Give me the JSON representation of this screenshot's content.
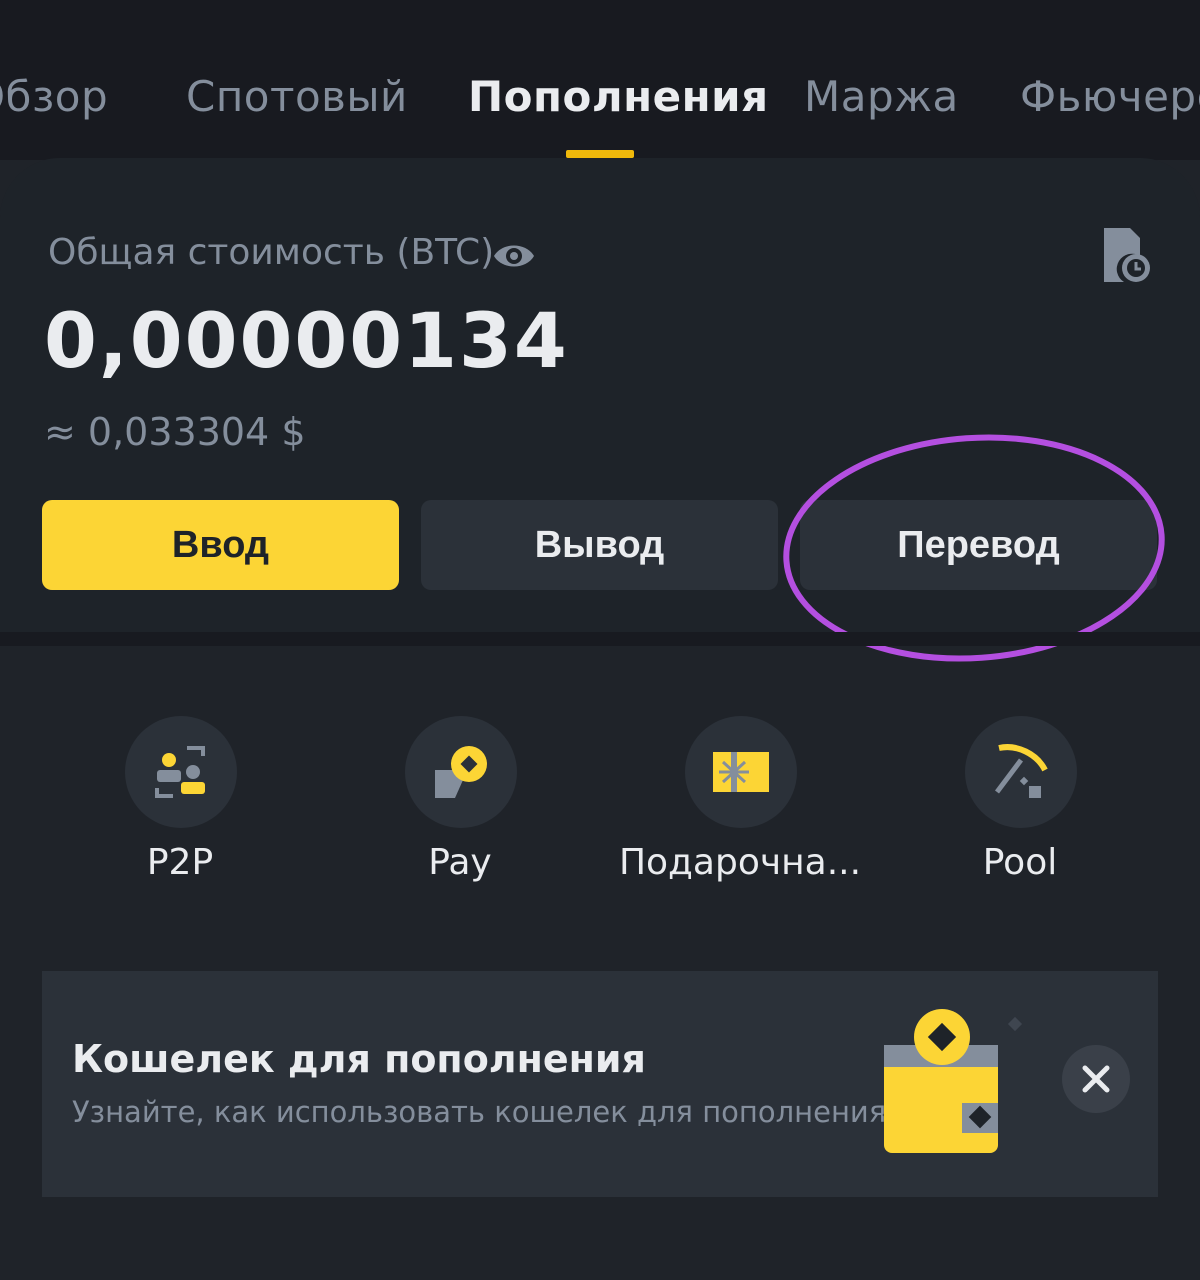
{
  "tabs": [
    {
      "label": "Обзор"
    },
    {
      "label": "Спотовый"
    },
    {
      "label": "Пополнения"
    },
    {
      "label": "Маржа"
    },
    {
      "label": "Фьючерсы"
    }
  ],
  "summary": {
    "label": "Общая стоимость (BTC)",
    "balance": "0,00000134",
    "approx": "≈ 0,033304 $"
  },
  "actions": {
    "deposit": "Ввод",
    "withdraw": "Вывод",
    "transfer": "Перевод"
  },
  "quick_actions": [
    {
      "label": "P2P",
      "icon": "p2p-icon"
    },
    {
      "label": "Pay",
      "icon": "pay-icon"
    },
    {
      "label": "Подарочна...",
      "icon": "gift-card-icon"
    },
    {
      "label": "Pool",
      "icon": "pool-icon"
    }
  ],
  "banner": {
    "title": "Кошелек для пополнения",
    "subtitle": "Узнайте, как использовать кошелек для пополнения"
  },
  "colors": {
    "accent": "#fcd535",
    "highlight": "#b44fe0",
    "background": "#1e2329",
    "button": "#2b3139"
  }
}
